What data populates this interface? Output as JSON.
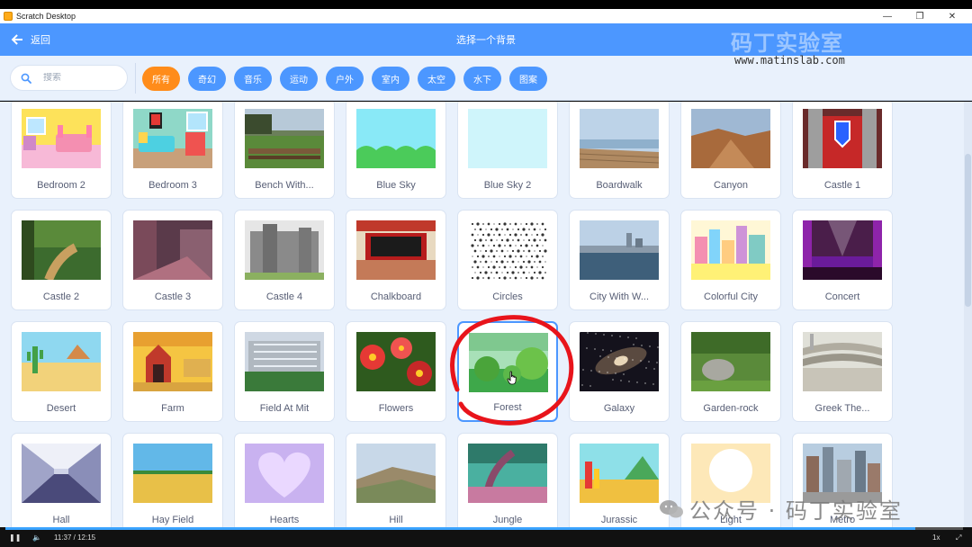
{
  "window": {
    "title": "Scratch Desktop",
    "minimize": "—",
    "restore": "❐",
    "close": "✕"
  },
  "header": {
    "back_label": "返回",
    "title": "选择一个背景"
  },
  "watermark": {
    "brand": "码丁实验室",
    "url": "www.matinslab.com",
    "wechat": "公众号 · 码丁实验室"
  },
  "search": {
    "placeholder": "搜索",
    "value": ""
  },
  "tags": [
    {
      "label": "所有",
      "active": true
    },
    {
      "label": "奇幻"
    },
    {
      "label": "音乐"
    },
    {
      "label": "运动"
    },
    {
      "label": "户外"
    },
    {
      "label": "室内"
    },
    {
      "label": "太空"
    },
    {
      "label": "水下"
    },
    {
      "label": "图案"
    }
  ],
  "backdrops": [
    {
      "name": "Bedroom 2"
    },
    {
      "name": "Bedroom 3"
    },
    {
      "name": "Bench With..."
    },
    {
      "name": "Blue Sky"
    },
    {
      "name": "Blue Sky 2"
    },
    {
      "name": "Boardwalk"
    },
    {
      "name": "Canyon"
    },
    {
      "name": "Castle 1"
    },
    {
      "name": "Castle 2"
    },
    {
      "name": "Castle 3"
    },
    {
      "name": "Castle 4"
    },
    {
      "name": "Chalkboard"
    },
    {
      "name": "Circles"
    },
    {
      "name": "City With W..."
    },
    {
      "name": "Colorful City"
    },
    {
      "name": "Concert"
    },
    {
      "name": "Desert"
    },
    {
      "name": "Farm"
    },
    {
      "name": "Field At Mit"
    },
    {
      "name": "Flowers"
    },
    {
      "name": "Forest",
      "selected": true
    },
    {
      "name": "Galaxy"
    },
    {
      "name": "Garden-rock"
    },
    {
      "name": "Greek The..."
    },
    {
      "name": "Hall"
    },
    {
      "name": "Hay Field"
    },
    {
      "name": "Hearts"
    },
    {
      "name": "Hill"
    },
    {
      "name": "Jungle"
    },
    {
      "name": "Jurassic"
    },
    {
      "name": "Light"
    },
    {
      "name": "Metro"
    }
  ],
  "player": {
    "time": "11:37 / 12:15",
    "speed": "1x",
    "progress": 0.95
  },
  "colors": {
    "accent": "#4c97ff",
    "active_tag": "#ff8c1a",
    "annotation": "#e8141b"
  }
}
